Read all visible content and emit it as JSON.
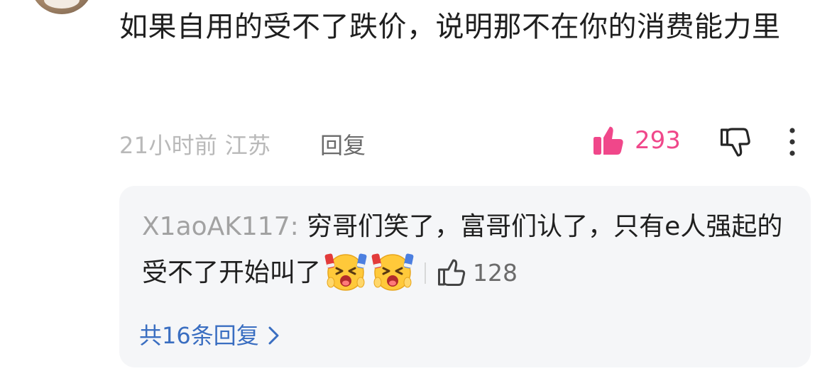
{
  "comment": {
    "text": "如果自用的受不了跌价，说明那不在你的消费能力里",
    "time_location": "21小时前 江苏",
    "reply_label": "回复",
    "like_count": "293",
    "like_color": "#f0478a"
  },
  "sub_reply": {
    "username": "X1aoAK117:",
    "text": " 穷哥们笑了，富哥们认了，只有e人强起的受不了开始叫了",
    "like_count": "128",
    "emojis": [
      "grimacing-face-emoji",
      "grimacing-face-emoji"
    ]
  },
  "replies_link": {
    "label": "共16条回复",
    "color": "#3a6ec1"
  },
  "icons": {
    "like": "thumbs-up-icon",
    "dislike": "thumbs-down-icon",
    "more": "more-vertical-icon",
    "reply_like": "thumbs-up-outline-icon",
    "chevron": "chevron-right-icon"
  }
}
